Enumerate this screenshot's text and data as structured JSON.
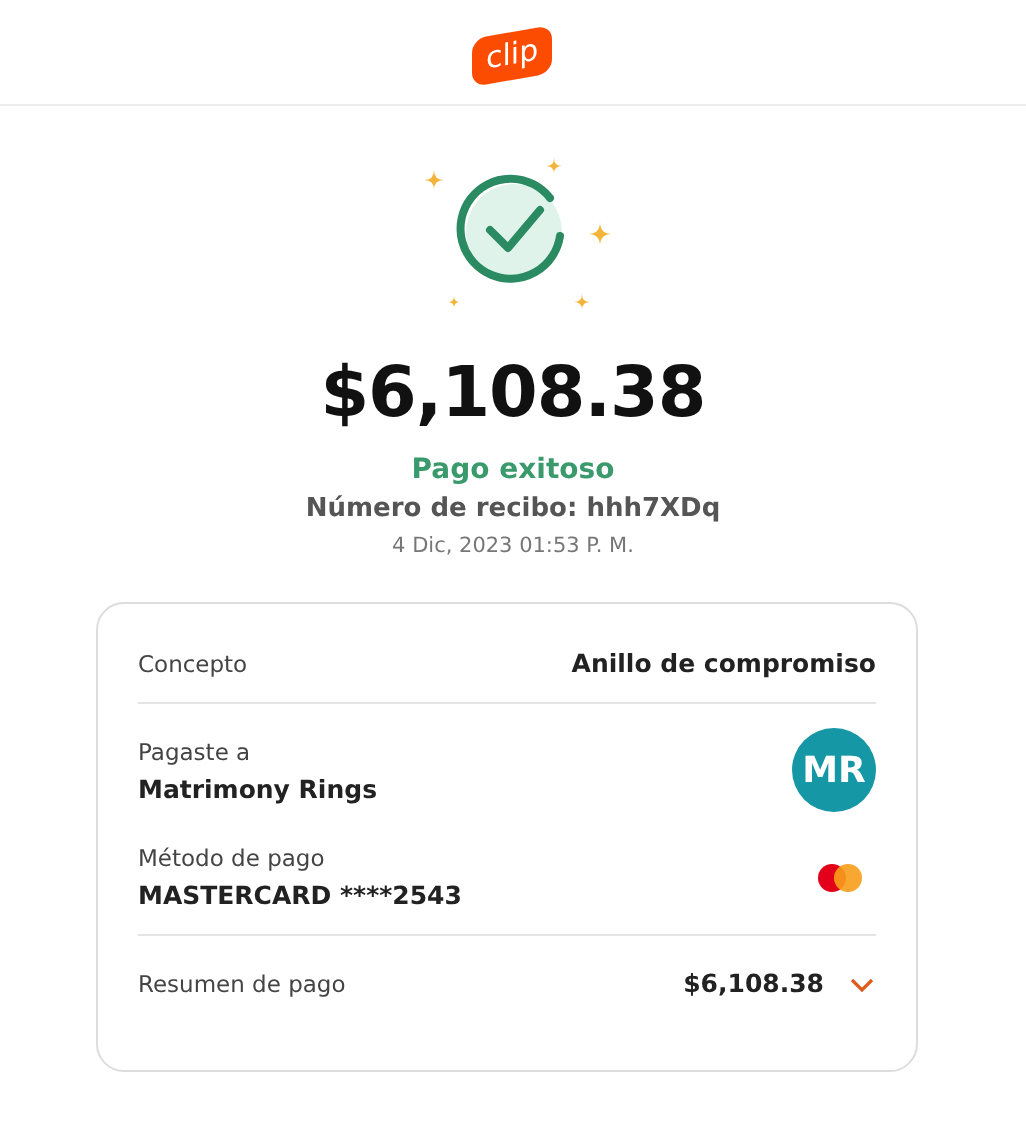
{
  "header": {
    "logo": "clip"
  },
  "hero": {
    "amount": "$6,108.38",
    "status": "Pago exitoso",
    "receipt": "Número de recibo: hhh7XDq",
    "date": "4 Dic, 2023 01:53 P. M."
  },
  "details": {
    "concept_label": "Concepto",
    "concept_value": "Anillo de compromiso",
    "payee_label": "Pagaste a",
    "payee_name": "Matrimony Rings",
    "payee_initials": "MR",
    "method_label": "Método de pago",
    "method_value": "MASTERCARD ****2543",
    "summary_label": "Resumen de pago",
    "summary_value": "$6,108.38",
    "summary_expanded": false
  }
}
